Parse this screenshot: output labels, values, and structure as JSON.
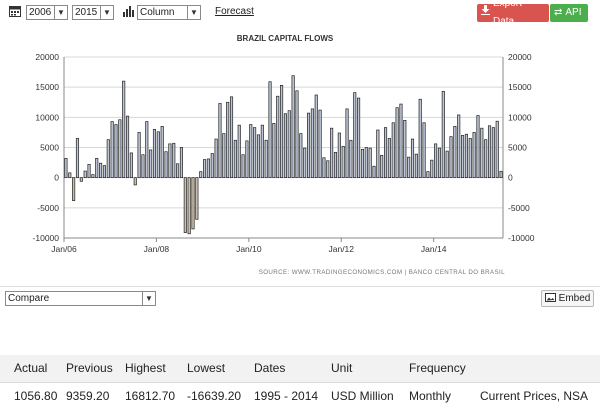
{
  "toolbar": {
    "start_year": "2006",
    "end_year": "2015",
    "chart_type": "Column",
    "forecast_label": "Forecast",
    "export_label": "Export Data",
    "api_label": "API",
    "icons": [
      "calendar-icon",
      "bar-chart-icon",
      "download-icon",
      "swap-icon"
    ]
  },
  "compare": {
    "label": "Compare",
    "embed_label": "Embed",
    "icons": [
      "image-icon"
    ]
  },
  "stats": {
    "headers": [
      "Actual",
      "Previous",
      "Highest",
      "Lowest",
      "Dates",
      "Unit",
      "Frequency",
      ""
    ],
    "values": [
      "1056.80",
      "9359.20",
      "16812.70",
      "-16639.20",
      "1995 - 2014",
      "USD Million",
      "Monthly",
      "Current Prices, NSA"
    ]
  },
  "colors": {
    "positive_bar": "#bcc5d6",
    "negative_bar": "#cdbfae",
    "bar_outline": "#222222",
    "export_button": "#d9534f",
    "api_button": "#4cae4c"
  },
  "chart_data": {
    "type": "bar",
    "title": "BRAZIL CAPITAL FLOWS",
    "source": "SOURCE: WWW.TRADINGECONOMICS.COM | BANCO CENTRAL DO BRASIL",
    "xlabel": "",
    "ylabel": "",
    "x_ticks": [
      "Jan/06",
      "Jan/08",
      "Jan/10",
      "Jan/12",
      "Jan/14"
    ],
    "y_ticks": [
      20000,
      15000,
      10000,
      5000,
      0,
      -5000,
      -10000
    ],
    "ylim": [
      -10000,
      20000
    ],
    "x_start": "Jan/06",
    "frequency": "monthly",
    "grid": "horizontal",
    "legend": "none",
    "values": [
      3200,
      800,
      -3800,
      6500,
      -600,
      1100,
      2200,
      500,
      3200,
      2400,
      2000,
      6300,
      9300,
      8800,
      9600,
      16000,
      10200,
      4100,
      -1200,
      7500,
      3800,
      9300,
      4600,
      8000,
      7600,
      8500,
      4300,
      5600,
      5700,
      2300,
      5000,
      -9100,
      -9300,
      -8500,
      -6900,
      1000,
      3000,
      3100,
      4000,
      6400,
      12300,
      7300,
      12500,
      13400,
      6200,
      8700,
      3800,
      6100,
      8800,
      8300,
      7100,
      8700,
      6200,
      15900,
      9000,
      13500,
      15300,
      10600,
      11100,
      16900,
      14400,
      7300,
      4900,
      10700,
      11400,
      13700,
      11200,
      3300,
      2800,
      8200,
      4200,
      7400,
      5200,
      11400,
      6200,
      14100,
      13200,
      4700,
      5000,
      4900,
      1900,
      7900,
      3700,
      8300,
      6500,
      9100,
      11600,
      12200,
      9500,
      3400,
      6400,
      3900,
      13000,
      9100,
      1000,
      2900,
      5600,
      4900,
      14300,
      4400,
      6800,
      8500,
      10400,
      7000,
      7200,
      6500,
      7500,
      10300,
      8200,
      6300,
      8600,
      8300,
      9359.2,
      1056.8
    ]
  }
}
